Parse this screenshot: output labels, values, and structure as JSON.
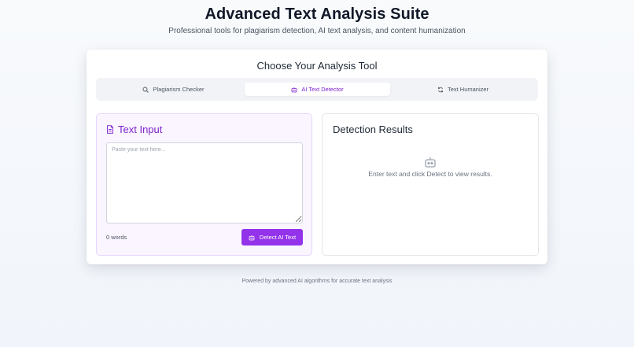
{
  "header": {
    "title": "Advanced Text Analysis Suite",
    "subtitle": "Professional tools for plagiarism detection, AI text analysis, and content humanization"
  },
  "tool_selector": {
    "title": "Choose Your Analysis Tool",
    "tabs": [
      {
        "label": "Plagiarism Checker",
        "icon": "search-icon",
        "active": false
      },
      {
        "label": "AI Text Detector",
        "icon": "robot-icon",
        "active": true
      },
      {
        "label": "Text Humanizer",
        "icon": "refresh-icon",
        "active": false
      }
    ]
  },
  "input_panel": {
    "title": "Text Input",
    "icon": "document-icon",
    "placeholder": "Paste your text here...",
    "value": "",
    "word_count": "0 words",
    "button_label": "Detect AI Text",
    "button_icon": "robot-icon"
  },
  "results_panel": {
    "title": "Detection Results",
    "icon": "robot-icon",
    "empty_message": "Enter text and click Detect to view results."
  },
  "footer": {
    "text": "Powered by advanced AI algorithms for accurate text analysis"
  },
  "colors": {
    "accent": "#9333ea",
    "accent_text": "#7e22ce",
    "panel_tint": "#faf5ff"
  }
}
